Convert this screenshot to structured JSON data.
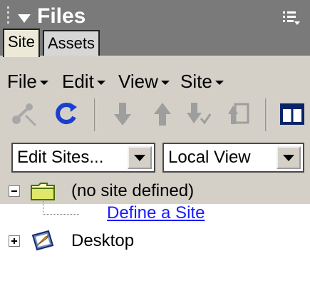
{
  "panel": {
    "title": "Files",
    "collapse_icon": "triangle-down-icon",
    "options_icon": "options-menu-icon",
    "tabs": [
      {
        "label": "Site",
        "active": true
      },
      {
        "label": "Assets",
        "active": false
      }
    ]
  },
  "menu": [
    {
      "label": "File"
    },
    {
      "label": "Edit"
    },
    {
      "label": "View"
    },
    {
      "label": "Site"
    }
  ],
  "toolbar": {
    "icons": [
      "connect-icon",
      "refresh-icon",
      "get-files-icon",
      "put-files-icon",
      "check-out-icon",
      "check-in-icon",
      "expand-panel-icon"
    ],
    "colors": {
      "refresh": "#1a3fd0",
      "arrows": "#9e9e9e",
      "expand": "#0a246a"
    }
  },
  "site_select": {
    "value": "Edit Sites..."
  },
  "view_select": {
    "value": "Local View"
  },
  "tree": {
    "root": {
      "label": "(no site defined)",
      "icon": "folder-icon",
      "expanded": true
    },
    "link": {
      "label": "Define a Site"
    },
    "desktop": {
      "label": "Desktop",
      "icon": "desktop-icon",
      "expanded": false
    }
  },
  "colors": {
    "header_bg": "#7a7a7a",
    "toolbar_bg": "#d4d0c8",
    "link": "#1a1aff"
  }
}
